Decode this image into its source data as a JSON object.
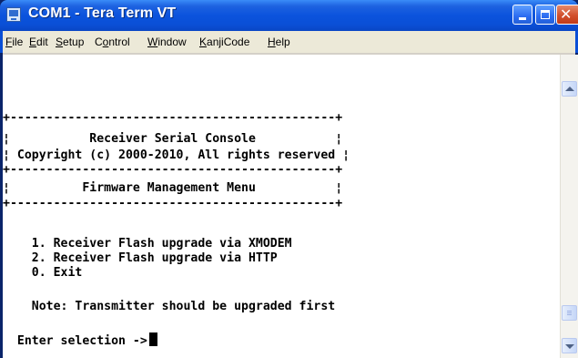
{
  "window": {
    "title": "COM1 - Tera Term VT"
  },
  "menu": [
    {
      "pre": "",
      "key": "F",
      "post": "ile"
    },
    {
      "pre": "",
      "key": "E",
      "post": "dit"
    },
    {
      "pre": "",
      "key": "S",
      "post": "etup"
    },
    {
      "pre": "C",
      "key": "o",
      "post": "ntrol"
    },
    {
      "pre": "",
      "key": "W",
      "post": "indow"
    },
    {
      "pre": "",
      "key": "K",
      "post": "anjiCode"
    },
    {
      "pre": "",
      "key": "H",
      "post": "elp"
    }
  ],
  "terminal": {
    "lines": [
      "+---------------------------------------------+",
      "¦           Receiver Serial Console           ¦",
      "¦ Copyright (c) 2000-2010, All rights reserved ¦",
      "+---------------------------------------------+",
      "¦          Firmware Management Menu           ¦",
      "+---------------------------------------------+",
      "",
      "    1. Receiver Flash upgrade via XMODEM",
      "    2. Receiver Flash upgrade via HTTP",
      "    0. Exit",
      "",
      "    Note: Transmitter should be upgraded first",
      "",
      "  Enter selection ->"
    ]
  }
}
